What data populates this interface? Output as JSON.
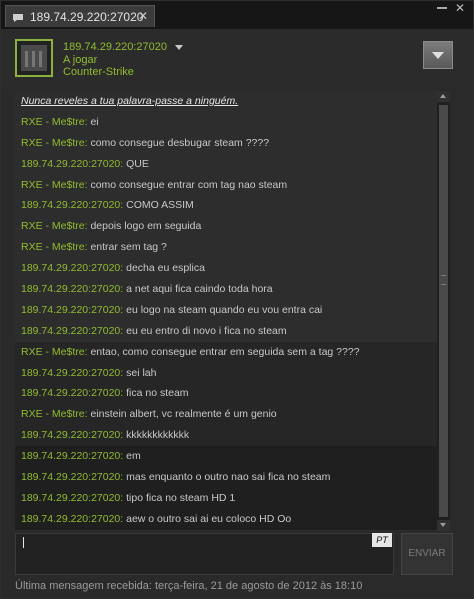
{
  "window": {
    "tab_title": "189.74.29.220:27020",
    "tab_close": "✕",
    "min_label": "",
    "close_label": "✕"
  },
  "header": {
    "name": "189.74.29.220:27020",
    "status": "A jogar",
    "game": "Counter-Strike"
  },
  "colors": {
    "accent_green": "#8fbc30",
    "background": "#2a2a2a",
    "text": "#c8c8c8"
  },
  "messages": [
    {
      "sender": "",
      "text": "Nunca reveles a tua palavra-passe a ninguém."
    },
    {
      "sender": "RXE - Me$tre:",
      "text": " ei"
    },
    {
      "sender": "RXE - Me$tre:",
      "text": " como consegue desbugar steam ????"
    },
    {
      "sender": "189.74.29.220:27020:",
      "text": " QUE"
    },
    {
      "sender": "RXE - Me$tre:",
      "text": " como consegue entrar com tag nao steam"
    },
    {
      "sender": "189.74.29.220:27020:",
      "text": " COMO ASSIM"
    },
    {
      "sender": "RXE - Me$tre:",
      "text": " depois logo em seguida"
    },
    {
      "sender": "RXE - Me$tre:",
      "text": " entrar sem tag ?"
    },
    {
      "sender": "189.74.29.220:27020:",
      "text": " decha eu esplica"
    },
    {
      "sender": "189.74.29.220:27020:",
      "text": " a net aqui fica caindo toda hora"
    },
    {
      "sender": "189.74.29.220:27020:",
      "text": " eu logo na steam quando eu vou entra cai"
    },
    {
      "sender": "189.74.29.220:27020:",
      "text": " eu eu entro di novo  i fica no steam"
    },
    {
      "sender": "RXE - Me$tre:",
      "text": " entao, como consegue entrar em seguida sem a tag ????"
    },
    {
      "sender": "189.74.29.220:27020:",
      "text": " sei lah"
    },
    {
      "sender": "189.74.29.220:27020:",
      "text": " fica no steam"
    },
    {
      "sender": "RXE - Me$tre:",
      "text": " einstein albert, vc realmente é um genio"
    },
    {
      "sender": "189.74.29.220:27020:",
      "text": " kkkkkkkkkkkk"
    },
    {
      "sender": "189.74.29.220:27020:",
      "text": " em"
    },
    {
      "sender": "189.74.29.220:27020:",
      "text": " mas enquanto o outro nao sai fica no steam"
    },
    {
      "sender": "189.74.29.220:27020:",
      "text": " tipo fica no steam HD 1"
    },
    {
      "sender": "189.74.29.220:27020:",
      "text": " aew o outro sai ai eu coloco HD Oo"
    }
  ],
  "input": {
    "value": "",
    "language": "PT",
    "send_label": "ENVIAR"
  },
  "footer": {
    "last_message": "Última mensagem recebida: terça-feira, 21 de agosto de 2012 às 18:10"
  }
}
